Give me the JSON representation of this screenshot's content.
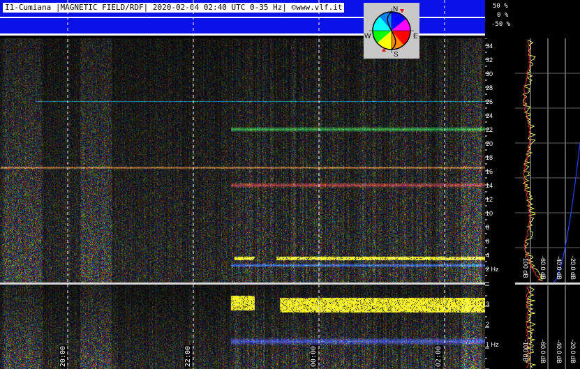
{
  "header": {
    "title": "I1-Cumiana |MAGNETIC FIELD/RDF| 2020-02-04 02:40 UTC 0-35 Hz| ©www.vlf.it",
    "percent_labels": [
      "50 %",
      "0 %",
      "-50 %"
    ]
  },
  "compass": {
    "n": "N",
    "s": "S",
    "e": "E",
    "w": "W"
  },
  "chart_data": {
    "type": "heatmap",
    "title": "I1-Cumiana |MAGNETIC FIELD/RDF| 2020-02-04 02:40 UTC 0-35 Hz| ©www.vlf.it",
    "x_ticks": [
      "20:00",
      "22:00",
      "00:00",
      "02:00"
    ],
    "main_panel": {
      "ylim": [
        0,
        35
      ],
      "y_ticks": [
        "2 Hz",
        "4",
        "6",
        "8",
        "10",
        "12",
        "14",
        "16",
        "18",
        "20",
        "22",
        "24",
        "26",
        "28",
        "30",
        "32",
        "34"
      ],
      "bands_hz": [
        3.5,
        16.5,
        14,
        22,
        26
      ]
    },
    "zoom_panel": {
      "y_ticks": [
        "1 Hz",
        "2",
        "3"
      ]
    },
    "level_panel": {
      "labels_main": [
        "-100 dB",
        "-60.0 dB",
        "-40.0 dB",
        "-20.0 dB"
      ],
      "labels_zoom": [
        "-100 dB",
        "-60.0 dB",
        "-40.0 dB",
        "-20.0 dB"
      ]
    },
    "colors": {
      "header_bg": "#0a12e8",
      "strong_band": "#ffff00",
      "grid": "#ffffff"
    }
  }
}
